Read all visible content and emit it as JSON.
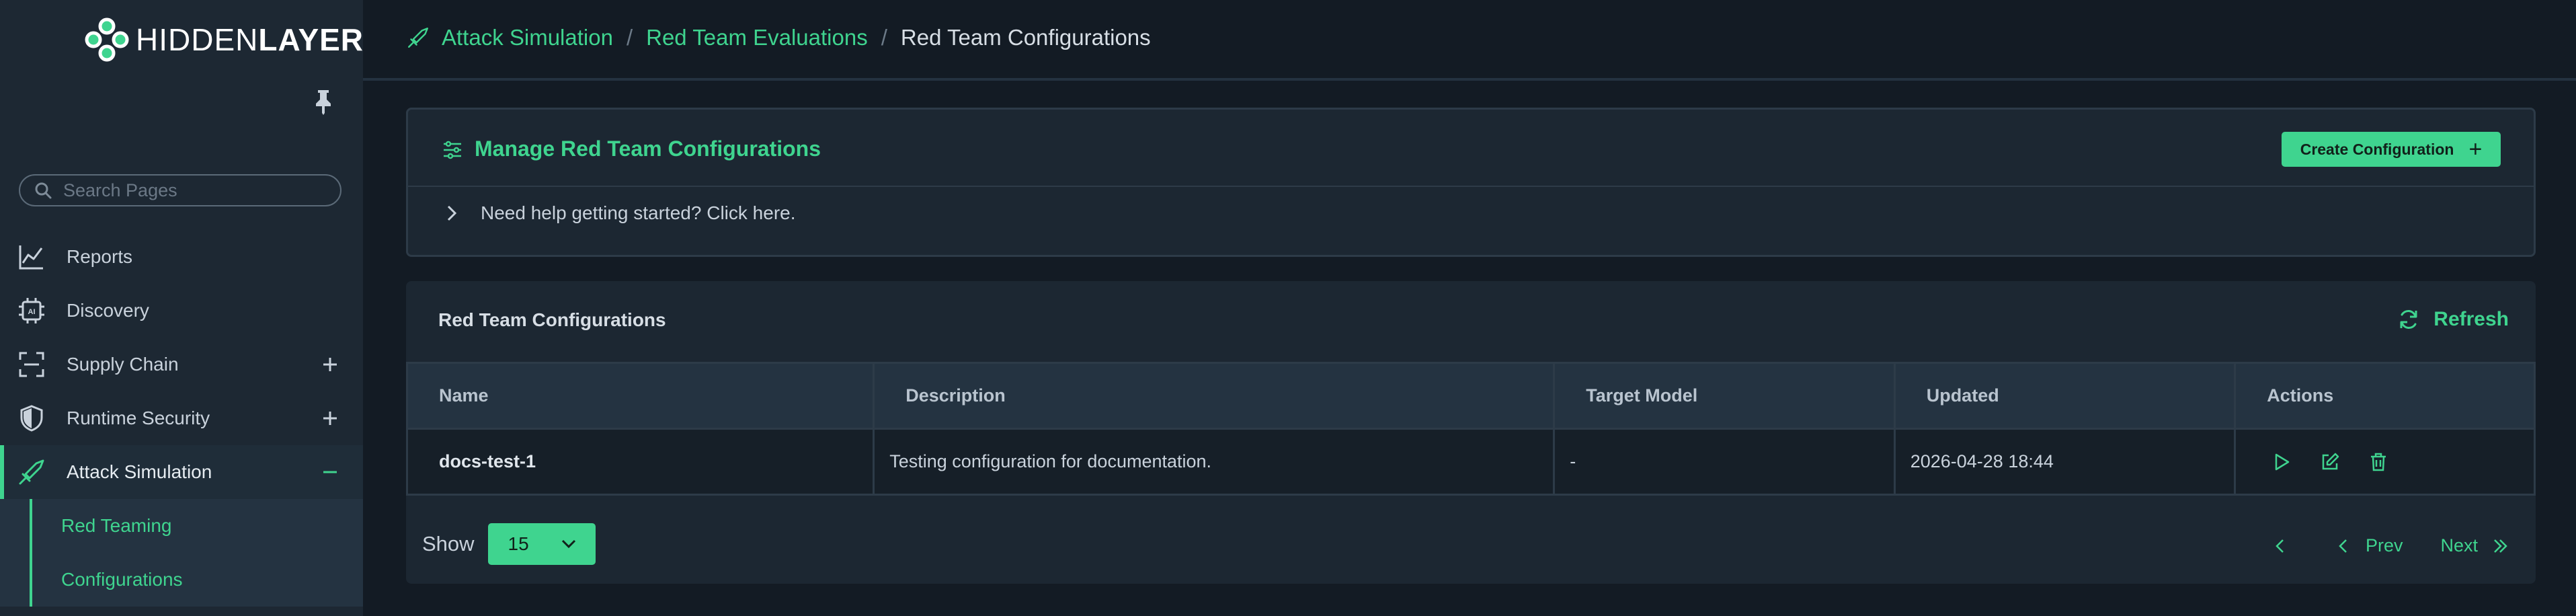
{
  "brand": {
    "logo_part1": "HIDDEN",
    "logo_part2": "LAYER"
  },
  "search": {
    "placeholder": "Search Pages"
  },
  "sidebar": {
    "items": [
      {
        "label": "Reports"
      },
      {
        "label": "Discovery"
      },
      {
        "label": "Supply Chain"
      },
      {
        "label": "Runtime Security"
      },
      {
        "label": "Attack Simulation"
      }
    ],
    "subitems": [
      {
        "label": "Red Teaming"
      },
      {
        "label": "Configurations"
      }
    ]
  },
  "breadcrumb": {
    "items": [
      "Attack Simulation",
      "Red Team Evaluations"
    ],
    "current": "Red Team Configurations",
    "separator": "/"
  },
  "manage_panel": {
    "title": "Manage Red Team Configurations",
    "create_label": "Create Configuration",
    "help_text": "Need help getting started? Click here."
  },
  "table_panel": {
    "title": "Red Team Configurations",
    "refresh_label": "Refresh",
    "columns": [
      "Name",
      "Description",
      "Target Model",
      "Updated",
      "Actions"
    ],
    "rows": [
      {
        "name": "docs-test-1",
        "description": "Testing configuration for documentation.",
        "target_model": "-",
        "updated": "2026-04-28 18:44"
      }
    ]
  },
  "pagination": {
    "show_label": "Show",
    "page_size": "15",
    "prev_label": "Prev",
    "next_label": "Next"
  },
  "colors": {
    "accent": "#3fd48f",
    "sidebar_bg": "#1d2833",
    "page_bg": "#131b24",
    "panel_bg": "#1c2732"
  }
}
